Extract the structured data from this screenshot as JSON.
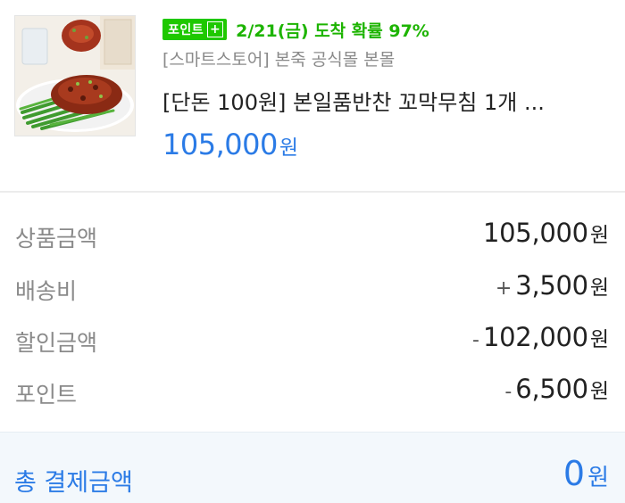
{
  "product": {
    "badge_label": "포인트",
    "badge_plus": "+",
    "delivery_text": "2/21(금) 도착 확률 97%",
    "store": "[스마트스토어] 본죽 공식몰 본몰",
    "title": "[단돈 100원] 본일품반찬 꼬막무침 1개 ...",
    "price": "105,000",
    "price_unit": "원",
    "thumbnail_icon": "product-photo"
  },
  "summary": {
    "rows": [
      {
        "label": "상품금액",
        "sign": "",
        "value": "105,000",
        "unit": "원"
      },
      {
        "label": "배송비",
        "sign": "+",
        "value": "3,500",
        "unit": "원"
      },
      {
        "label": "할인금액",
        "sign": "-",
        "value": "102,000",
        "unit": "원"
      },
      {
        "label": "포인트",
        "sign": "-",
        "value": "6,500",
        "unit": "원"
      }
    ]
  },
  "total": {
    "label": "총 결제금액",
    "value": "0",
    "unit": "원"
  },
  "colors": {
    "accent_blue": "#2b7be6",
    "point_green": "#1ec800",
    "delivery_green": "#1db400"
  }
}
